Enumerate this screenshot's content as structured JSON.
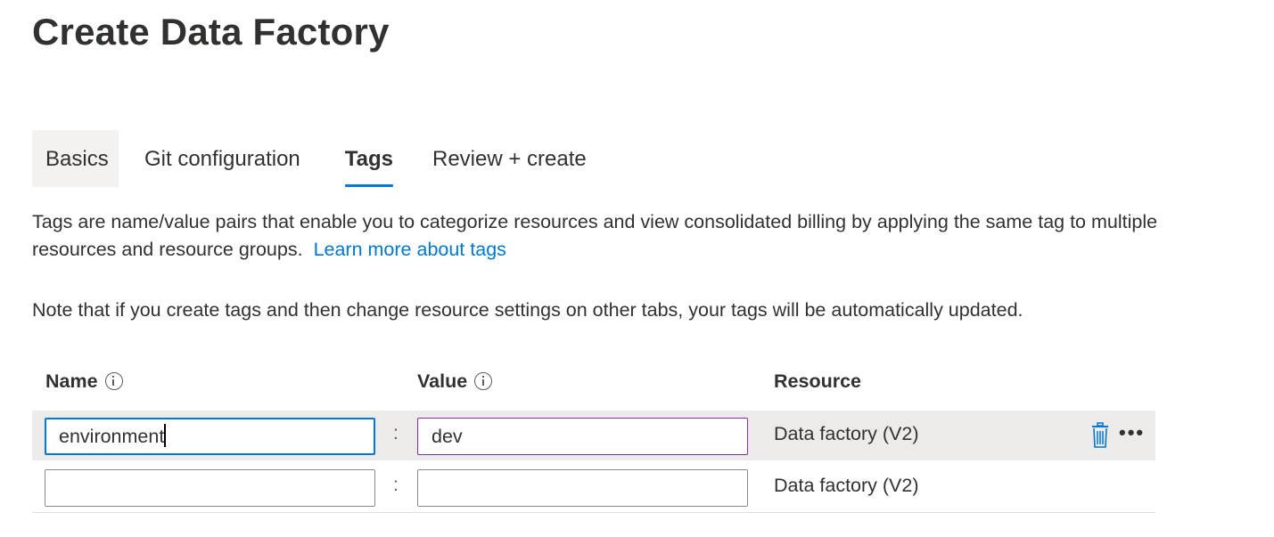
{
  "page": {
    "title": "Create Data Factory"
  },
  "tabs": [
    {
      "label": "Basics"
    },
    {
      "label": "Git configuration"
    },
    {
      "label": "Tags"
    },
    {
      "label": "Review + create"
    }
  ],
  "description": {
    "text": "Tags are name/value pairs that enable you to categorize resources and view consolidated billing by applying the same tag to multiple resources and resource groups.",
    "link": "Learn more about tags"
  },
  "note": "Note that if you create tags and then change resource settings on other tabs, your tags will be automatically updated.",
  "grid": {
    "headers": {
      "name": "Name",
      "value": "Value",
      "resource": "Resource"
    },
    "rows": [
      {
        "name": "environment",
        "separator": ":",
        "value": "dev",
        "resource": "Data factory (V2)"
      },
      {
        "name": "",
        "separator": ":",
        "value": "",
        "resource": "Data factory (V2)"
      }
    ],
    "row_actions": {
      "delete_icon": "trash-icon",
      "more_icon": "more-options-icon",
      "more_text": "•••"
    }
  },
  "colors": {
    "accent": "#0078d4",
    "link": "#0078d4",
    "hover_background": "#f3f2f1",
    "selected_row": "#edebe9",
    "value_field_border": "#8a2da5"
  }
}
